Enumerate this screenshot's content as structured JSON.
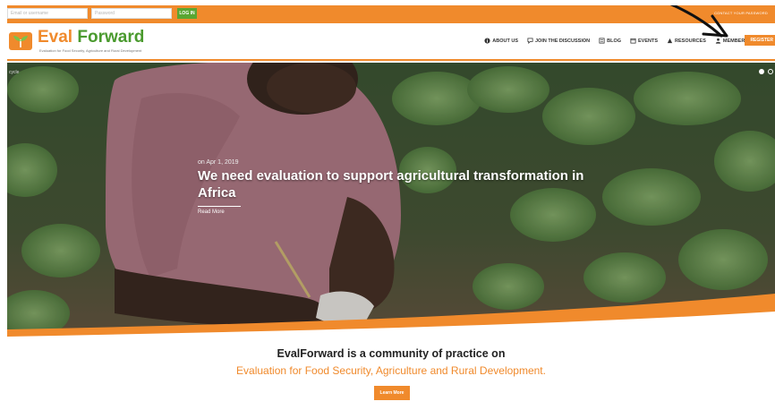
{
  "topbar": {
    "username_placeholder": "Email or username",
    "password_placeholder": "Password",
    "login_label": "LOG IN",
    "links": "CONTACT  YOUR PASSWORD"
  },
  "brand": {
    "name_part1": "Eval",
    "name_part2": "Forward",
    "tagline": "Evaluation for Food Security, Agriculture and Rural Development"
  },
  "nav": {
    "items": [
      {
        "label": "ABOUT US",
        "icon": "info-icon"
      },
      {
        "label": "JOIN THE DISCUSSION",
        "icon": "discussion-icon"
      },
      {
        "label": "BLOG",
        "icon": "blog-icon"
      },
      {
        "label": "EVENTS",
        "icon": "calendar-icon"
      },
      {
        "label": "RESOURCES",
        "icon": "resources-icon"
      },
      {
        "label": "MEMBERS",
        "icon": "user-icon"
      }
    ],
    "register_label": "REGISTER"
  },
  "hero": {
    "slide_label": "cycle",
    "date": "on Apr 1, 2019",
    "title": "We need evaluation to support agricultural transformation in Africa",
    "read_more": "Read More"
  },
  "mission": {
    "line1": "EvalForward is a community of practice on",
    "line2": "Evaluation for Food Security, Agriculture and Rural Development.",
    "learn_more": "Learn More"
  },
  "colors": {
    "accent": "#f08a2c",
    "brand_green": "#4a9a2e",
    "login_green": "#5aa632"
  }
}
